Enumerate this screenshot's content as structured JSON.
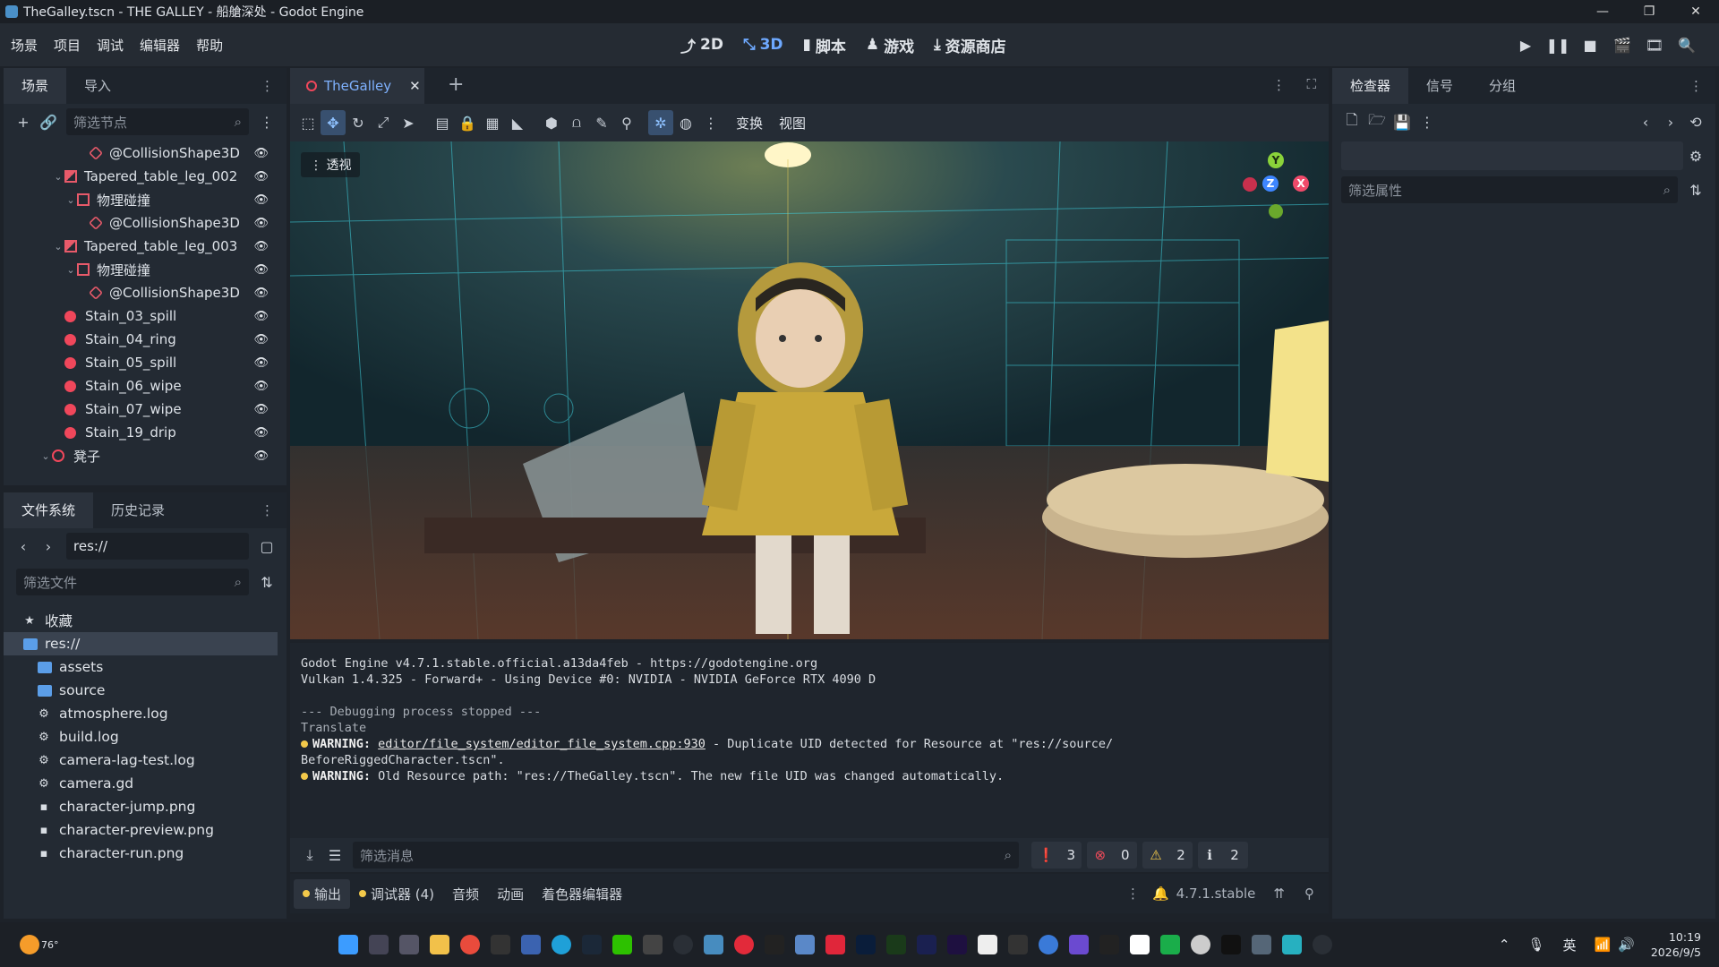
{
  "window": {
    "title": "TheGalley.tscn - THE GALLEY - 船艙深处 - Godot Engine",
    "controls": [
      "—",
      "❐",
      "✕"
    ]
  },
  "menu": [
    "场景",
    "项目",
    "调试",
    "编辑器",
    "帮助"
  ],
  "main_modes": [
    {
      "label": "2D",
      "icon": "2d-icon",
      "active": false
    },
    {
      "label": "3D",
      "icon": "3d-icon",
      "active": true
    },
    {
      "label": "脚本",
      "icon": "script-icon",
      "active": false
    },
    {
      "label": "游戏",
      "icon": "game-icon",
      "active": false
    },
    {
      "label": "资源商店",
      "icon": "assetlib-icon",
      "active": false
    }
  ],
  "scene_dock": {
    "tabs": [
      "场景",
      "导入"
    ],
    "filter_placeholder": "筛选节点",
    "nodes": [
      {
        "label": "@CollisionShape3D",
        "indent": 3,
        "icon": "collision-shape-icon",
        "arrow": ""
      },
      {
        "label": "Tapered_table_leg_002",
        "indent": 1,
        "icon": "mesh-instance-icon",
        "arrow": "⌄"
      },
      {
        "label": "物理碰撞",
        "indent": 2,
        "icon": "static-body-icon",
        "arrow": "⌄"
      },
      {
        "label": "@CollisionShape3D",
        "indent": 3,
        "icon": "collision-shape-icon",
        "arrow": ""
      },
      {
        "label": "Tapered_table_leg_003",
        "indent": 1,
        "icon": "mesh-instance-icon",
        "arrow": "⌄"
      },
      {
        "label": "物理碰撞",
        "indent": 2,
        "icon": "static-body-icon",
        "arrow": "⌄"
      },
      {
        "label": "@CollisionShape3D",
        "indent": 3,
        "icon": "collision-shape-icon",
        "arrow": ""
      },
      {
        "label": "Stain_03_spill",
        "indent": 1,
        "icon": "decal-icon",
        "arrow": ""
      },
      {
        "label": "Stain_04_ring",
        "indent": 1,
        "icon": "decal-icon",
        "arrow": ""
      },
      {
        "label": "Stain_05_spill",
        "indent": 1,
        "icon": "decal-icon",
        "arrow": ""
      },
      {
        "label": "Stain_06_wipe",
        "indent": 1,
        "icon": "decal-icon",
        "arrow": ""
      },
      {
        "label": "Stain_07_wipe",
        "indent": 1,
        "icon": "decal-icon",
        "arrow": ""
      },
      {
        "label": "Stain_19_drip",
        "indent": 1,
        "icon": "decal-icon",
        "arrow": ""
      },
      {
        "label": "凳子",
        "indent": 0,
        "icon": "node3d-icon",
        "arrow": "⌄"
      }
    ]
  },
  "filesystem_dock": {
    "tabs": [
      "文件系统",
      "历史记录"
    ],
    "path": "res://",
    "filter_placeholder": "筛选文件",
    "items": [
      {
        "label": "收藏",
        "type": "favorites",
        "indent": 0
      },
      {
        "label": "res://",
        "type": "folder",
        "indent": 0,
        "selected": true
      },
      {
        "label": "assets",
        "type": "folder",
        "indent": 1
      },
      {
        "label": "source",
        "type": "folder",
        "indent": 1
      },
      {
        "label": "atmosphere.log",
        "type": "log",
        "indent": 1
      },
      {
        "label": "build.log",
        "type": "log",
        "indent": 1
      },
      {
        "label": "camera-lag-test.log",
        "type": "log",
        "indent": 1
      },
      {
        "label": "camera.gd",
        "type": "script",
        "indent": 1
      },
      {
        "label": "character-jump.png",
        "type": "image",
        "indent": 1
      },
      {
        "label": "character-preview.png",
        "type": "image",
        "indent": 1
      },
      {
        "label": "character-run.png",
        "type": "image",
        "indent": 1
      }
    ]
  },
  "scene_tabs": {
    "active": "TheGalley",
    "add": "+"
  },
  "viewport_toolbar": {
    "transform_menu": "变换",
    "view_menu": "视图",
    "perspective_label": "透视"
  },
  "gizmo": {
    "y": "Y",
    "z": "Z",
    "x": "X"
  },
  "output": {
    "lines": [
      {
        "type": "info",
        "text": "Godot Engine v4.7.1.stable.official.a13da4feb - https://godotengine.org"
      },
      {
        "type": "info",
        "text": "Vulkan 1.4.325 - Forward+ - Using Device #0: NVIDIA - NVIDIA GeForce RTX 4090 D"
      },
      {
        "type": "blank",
        "text": ""
      },
      {
        "type": "dim",
        "text": "--- Debugging process stopped ---"
      },
      {
        "type": "dim",
        "text": "Translate"
      }
    ],
    "warning1": {
      "label": "WARNING:",
      "link": "editor/file_system/editor_file_system.cpp:930",
      "text": " - Duplicate UID detected for Resource at \"res://source/",
      "cont": "BeforeRiggedCharacter.tscn\"."
    },
    "warning2": {
      "label": "WARNING:",
      "text": " Old Resource path: \"res://TheGalley.tscn\". The new file UID was changed automatically."
    },
    "filter_placeholder": "筛选消息",
    "counts": {
      "messages": "3",
      "errors": "0",
      "warnings": "2",
      "info": "2"
    }
  },
  "bottom_tabs": [
    "输出",
    "调试器 (4)",
    "音频",
    "动画",
    "着色器编辑器"
  ],
  "version": "4.7.1.stable",
  "inspector": {
    "tabs": [
      "检查器",
      "信号",
      "分组"
    ],
    "filter_placeholder": "筛选属性"
  },
  "taskbar": {
    "weather": "76°",
    "ime": "英",
    "time": "10:19",
    "date": "2026/9/5"
  }
}
